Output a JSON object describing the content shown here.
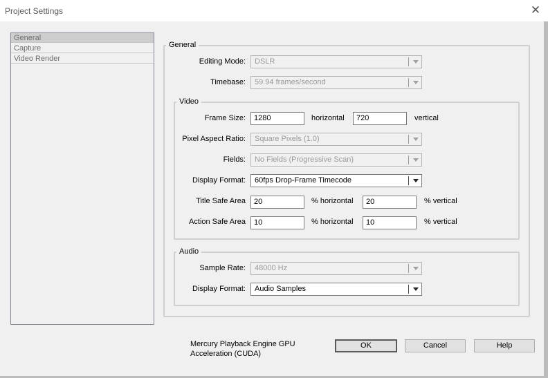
{
  "window": {
    "title": "Project Settings"
  },
  "nav": {
    "items": [
      "General",
      "Capture",
      "Video Render"
    ]
  },
  "general": {
    "legend": "General",
    "editing_mode": {
      "label": "Editing Mode:",
      "value": "DSLR"
    },
    "timebase": {
      "label": "Timebase:",
      "value": "59.94 frames/second"
    }
  },
  "video": {
    "legend": "Video",
    "frame_size": {
      "label": "Frame Size:",
      "width": "1280",
      "width_unit": "horizontal",
      "height": "720",
      "height_unit": "vertical"
    },
    "pixel_aspect": {
      "label": "Pixel Aspect Ratio:",
      "value": "Square Pixels (1.0)"
    },
    "fields": {
      "label": "Fields:",
      "value": "No Fields (Progressive Scan)"
    },
    "display_format": {
      "label": "Display Format:",
      "value": "60fps Drop-Frame Timecode"
    },
    "title_safe": {
      "label": "Title Safe Area",
      "h": "20",
      "h_unit": "% horizontal",
      "v": "20",
      "v_unit": "% vertical"
    },
    "action_safe": {
      "label": "Action Safe Area",
      "h": "10",
      "h_unit": "% horizontal",
      "v": "10",
      "v_unit": "% vertical"
    }
  },
  "audio": {
    "legend": "Audio",
    "sample_rate": {
      "label": "Sample Rate:",
      "value": "48000 Hz"
    },
    "display_format": {
      "label": "Display Format:",
      "value": "Audio Samples"
    }
  },
  "footer": {
    "note_line1": "Mercury Playback Engine GPU",
    "note_line2": "Acceleration (CUDA)",
    "ok": "OK",
    "cancel": "Cancel",
    "help": "Help"
  }
}
